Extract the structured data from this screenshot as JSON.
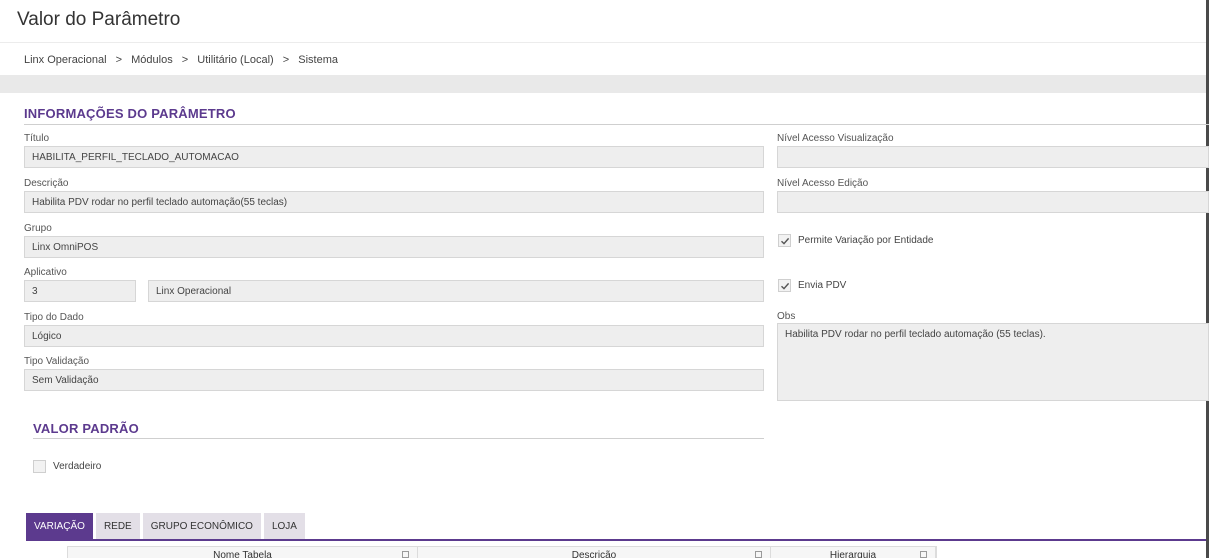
{
  "page": {
    "title": "Valor do Parâmetro"
  },
  "breadcrumb": [
    "Linx Operacional",
    "Módulos",
    "Utilitário (Local)",
    "Sistema"
  ],
  "breadcrumb_separator": ">",
  "info_section": {
    "title": "INFORMAÇÕES DO PARÂMETRO",
    "titulo_label": "Título",
    "titulo_value": "HABILITA_PERFIL_TECLADO_AUTOMACAO",
    "descricao_label": "Descrição",
    "descricao_value": "Habilita PDV rodar no perfil teclado automação(55 teclas)",
    "grupo_label": "Grupo",
    "grupo_value": "Linx OmniPOS",
    "aplicativo_label": "Aplicativo",
    "aplicativo_code": "3",
    "aplicativo_name": "Linx Operacional",
    "tipo_dado_label": "Tipo do Dado",
    "tipo_dado_value": "Lógico",
    "tipo_validacao_label": "Tipo Validação",
    "tipo_validacao_value": "Sem Validação",
    "nivel_visualizacao_label": "Nível Acesso Visualização",
    "nivel_visualizacao_value": "",
    "nivel_edicao_label": "Nível Acesso Edição",
    "nivel_edicao_value": "",
    "permite_variacao_label": "Permite Variação por Entidade",
    "permite_variacao_checked": true,
    "envia_pdv_label": "Envia PDV",
    "envia_pdv_checked": true,
    "obs_label": "Obs",
    "obs_value": "Habilita PDV rodar no perfil teclado automação (55 teclas)."
  },
  "default_section": {
    "title": "VALOR PADRÃO",
    "verdadeiro_label": "Verdadeiro",
    "verdadeiro_checked": false
  },
  "tabs": [
    {
      "label": "VARIAÇÃO",
      "active": true
    },
    {
      "label": "REDE",
      "active": false
    },
    {
      "label": "GRUPO ECONÔMICO",
      "active": false
    },
    {
      "label": "LOJA",
      "active": false
    }
  ],
  "grid": {
    "columns": [
      "Nome Tabela",
      "Descrição",
      "Hierarquia"
    ]
  },
  "colors": {
    "accent": "#5c3a8e",
    "field_bg": "#eeeeee"
  }
}
